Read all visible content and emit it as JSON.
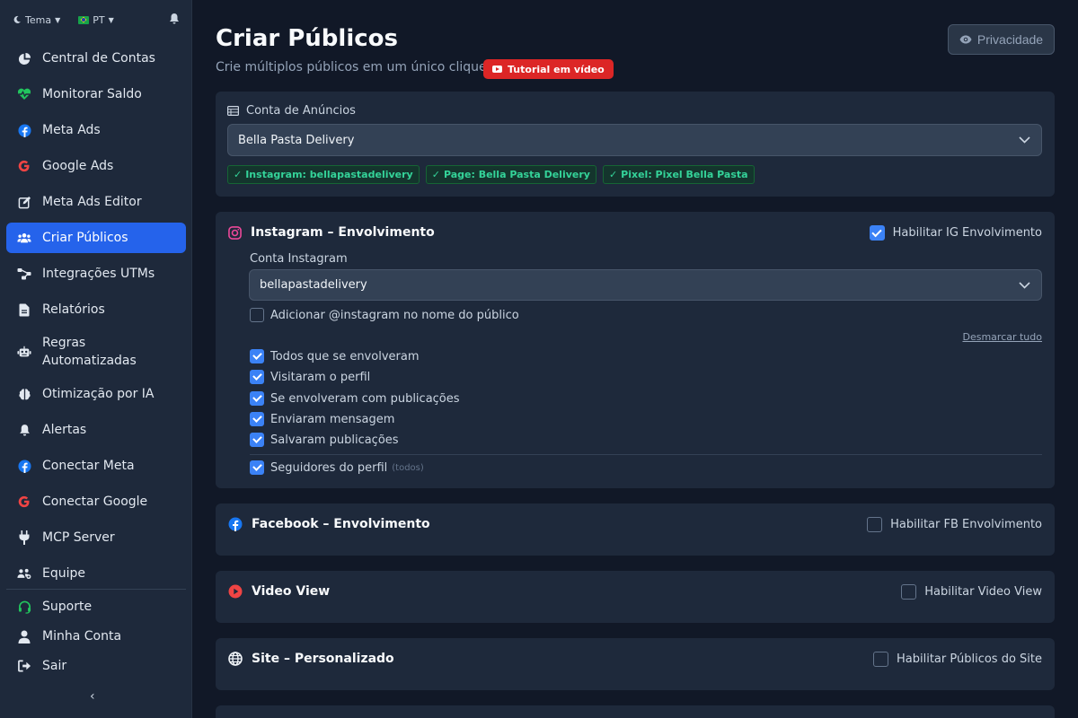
{
  "sidebar": {
    "theme_label": "Tema",
    "lang_label": "PT",
    "items": [
      {
        "label": "Central de Contas",
        "icon": "chart-pie-icon"
      },
      {
        "label": "Monitorar Saldo",
        "icon": "heart-pulse-icon"
      },
      {
        "label": "Meta Ads",
        "icon": "facebook-icon"
      },
      {
        "label": "Google Ads",
        "icon": "google-icon"
      },
      {
        "label": "Meta Ads Editor",
        "icon": "edit-icon"
      },
      {
        "label": "Criar Públicos",
        "icon": "users-icon"
      },
      {
        "label": "Integrações UTMs",
        "icon": "share-icon"
      },
      {
        "label": "Relatórios",
        "icon": "file-icon"
      },
      {
        "label": "Regras Automatizadas",
        "icon": "robot-icon"
      },
      {
        "label": "Otimização por IA",
        "icon": "brain-icon"
      },
      {
        "label": "Alertas",
        "icon": "bell-icon"
      },
      {
        "label": "Conectar Meta",
        "icon": "facebook-icon"
      },
      {
        "label": "Conectar Google",
        "icon": "google-icon"
      },
      {
        "label": "MCP Server",
        "icon": "plug-icon"
      },
      {
        "label": "Equipe",
        "icon": "team-icon"
      }
    ],
    "bottom": [
      {
        "label": "Suporte",
        "icon": "headset-icon"
      },
      {
        "label": "Minha Conta",
        "icon": "user-icon"
      },
      {
        "label": "Sair",
        "icon": "logout-icon"
      }
    ],
    "collapse_glyph": "‹"
  },
  "header": {
    "title": "Criar Públicos",
    "subtitle": "Crie múltiplos públicos em um único clique",
    "tutorial_label": "Tutorial em vídeo",
    "privacy_label": "Privacidade"
  },
  "account": {
    "label": "Conta de Anúncios",
    "selected": "Bella Pasta Delivery",
    "tags": [
      "Instagram: bellapastadelivery",
      "Page: Bella Pasta Delivery",
      "Pixel: Pixel Bella Pasta"
    ]
  },
  "instagram": {
    "title": "Instagram – Envolvimento",
    "enable_label": "Habilitar IG Envolvimento",
    "enabled": true,
    "account_label": "Conta Instagram",
    "account_value": "bellapastadelivery",
    "add_name_label": "Adicionar @instagram no nome do público",
    "unselect_all": "Desmarcar tudo",
    "options": [
      "Todos que se envolveram",
      "Visitaram o perfil",
      "Se envolveram com publicações",
      "Enviaram mensagem",
      "Salvaram publicações"
    ],
    "followers_label": "Seguidores do perfil",
    "followers_note": "(todos)"
  },
  "facebook": {
    "title": "Facebook – Envolvimento",
    "enable_label": "Habilitar FB Envolvimento",
    "enabled": false
  },
  "video": {
    "title": "Video View",
    "enable_label": "Habilitar Video View",
    "enabled": false
  },
  "site": {
    "title": "Site – Personalizado",
    "enable_label": "Habilitar Públicos do Site",
    "enabled": false
  },
  "colors": {
    "accent": "#2563eb",
    "bg": "#111827",
    "panel": "#1e293b",
    "tag_text": "#34d399",
    "tutorial": "#dc2626"
  }
}
